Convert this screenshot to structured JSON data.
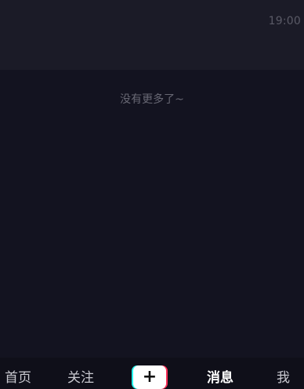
{
  "status": {
    "time": "19:00"
  },
  "feed": {
    "end_hint": "没有更多了~"
  },
  "tabbar": {
    "tabs": [
      {
        "label": "首页"
      },
      {
        "label": "关注"
      },
      {
        "label": "消息",
        "active": true
      },
      {
        "label": "我"
      }
    ],
    "create_symbol": "+"
  },
  "colors": {
    "background": "#131320",
    "card": "#1b1b27",
    "accent_cyan": "#25f4ee",
    "accent_pink": "#fe2c55"
  },
  "icons": [
    "plus-icon"
  ]
}
